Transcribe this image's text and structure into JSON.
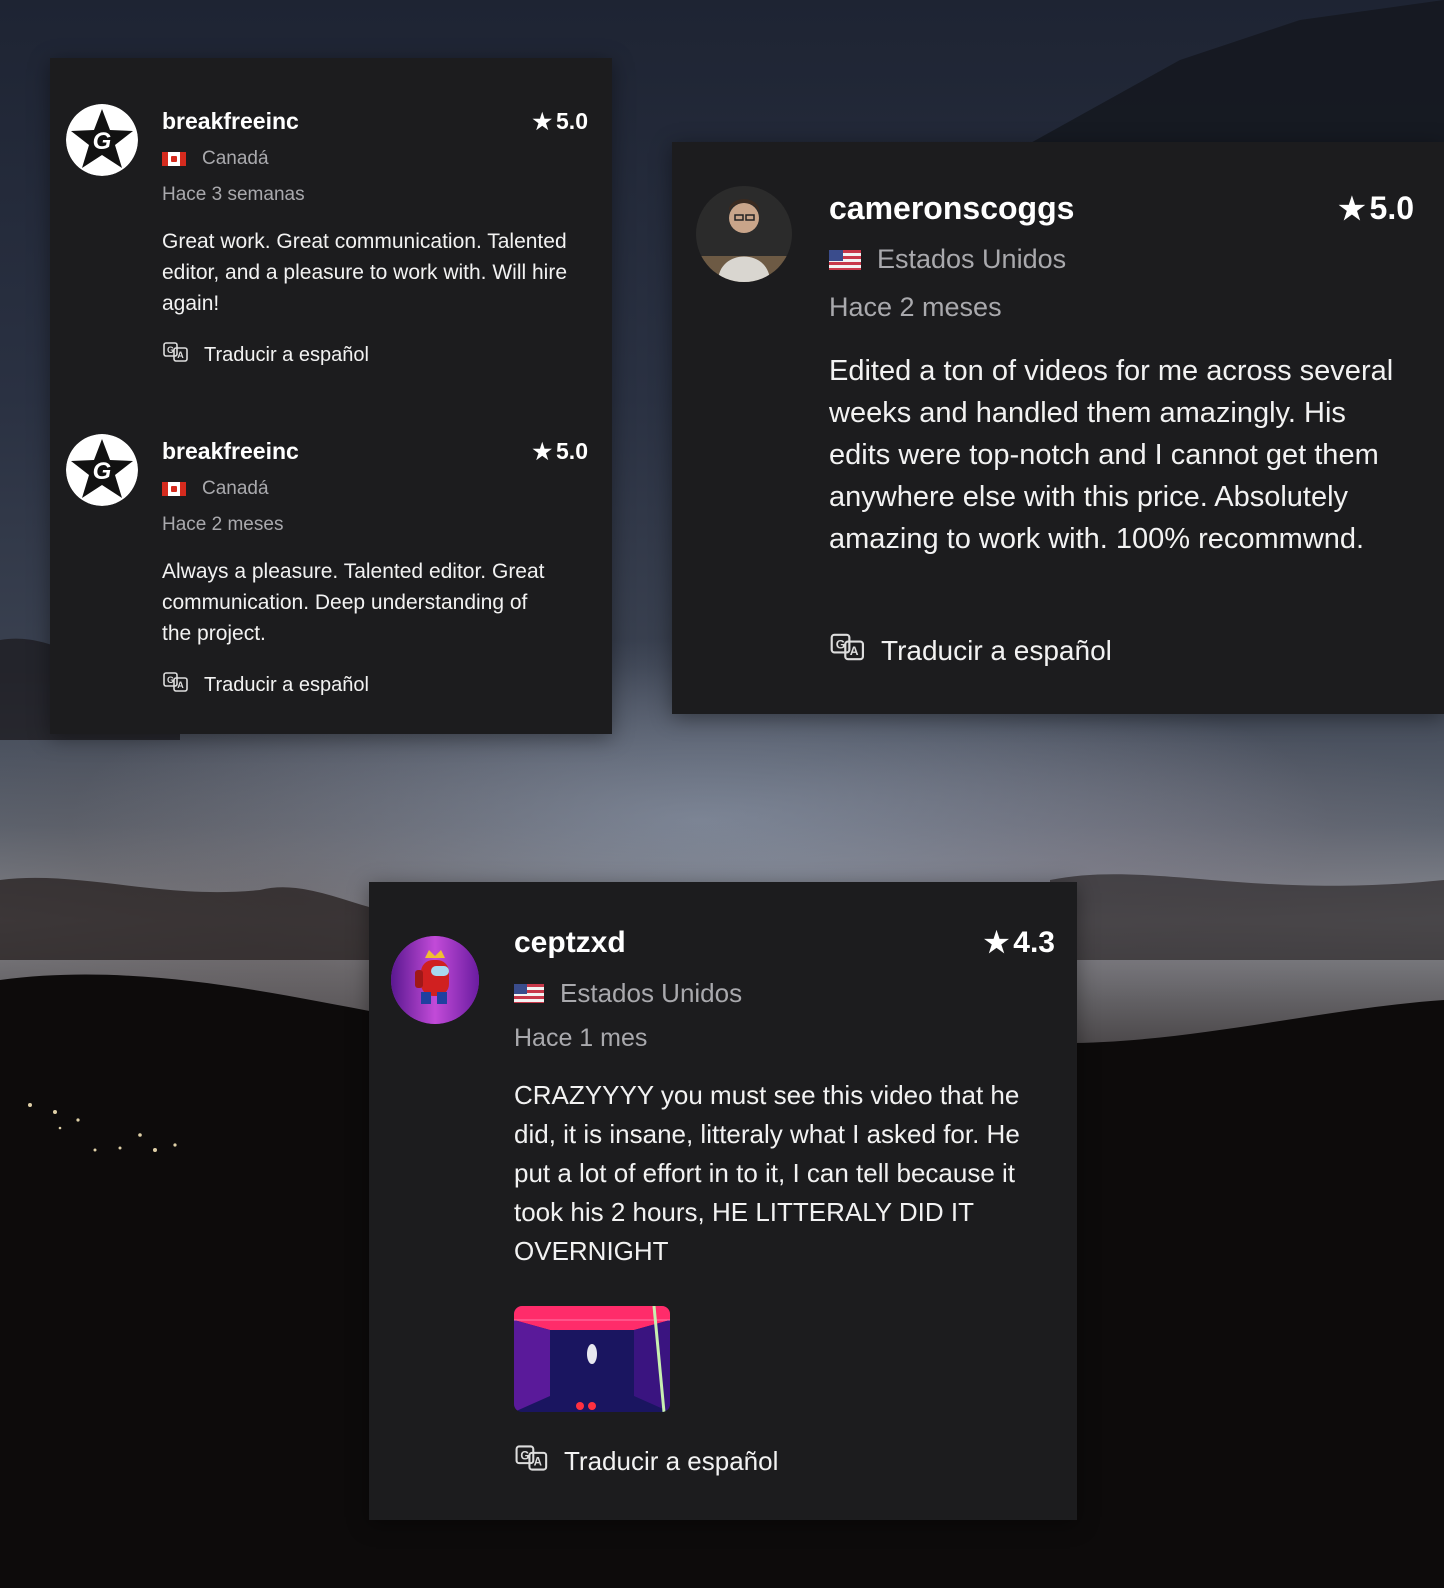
{
  "card1": {
    "reviews": [
      {
        "username": "breakfreeinc",
        "rating": "5.0",
        "country": "Canadá",
        "time": "Hace 3 semanas",
        "text": "Great work. Great communication. Talented editor, and a pleasure to work with. Will hire again!",
        "translate": "Traducir a español"
      },
      {
        "username": "breakfreeinc",
        "rating": "5.0",
        "country": "Canadá",
        "time": "Hace 2 meses",
        "text": "Always a pleasure. Talented editor. Great communication. Deep understanding of the project.",
        "translate": "Traducir a español"
      }
    ]
  },
  "card2": {
    "username": "cameronscoggs",
    "rating": "5.0",
    "country": "Estados Unidos",
    "time": "Hace 2 meses",
    "text": "Edited a ton of videos for me across several weeks and handled them amazingly. His edits were top-notch and I cannot get them anywhere else with this price. Absolutely amazing to work with. 100% recommwnd.",
    "translate": "Traducir a español"
  },
  "card3": {
    "username": "ceptzxd",
    "rating": "4.3",
    "country": "Estados Unidos",
    "time": "Hace 1 mes",
    "text": "CRAZYYYY you must see this video that he did, it is insane, litteraly what I asked for. He put a lot of effort in to it, I can tell because it took his 2 hours, HE LITTERALY DID IT OVERNIGHT",
    "translate": "Traducir a español"
  },
  "icons": {
    "star": "star-icon",
    "translate": "translate-icon",
    "flag_canada": "canada-flag-icon",
    "flag_us": "us-flag-icon"
  },
  "colors": {
    "card_bg": "#1c1c1e",
    "muted_text": "#a9a9ad",
    "text": "#ffffff"
  }
}
